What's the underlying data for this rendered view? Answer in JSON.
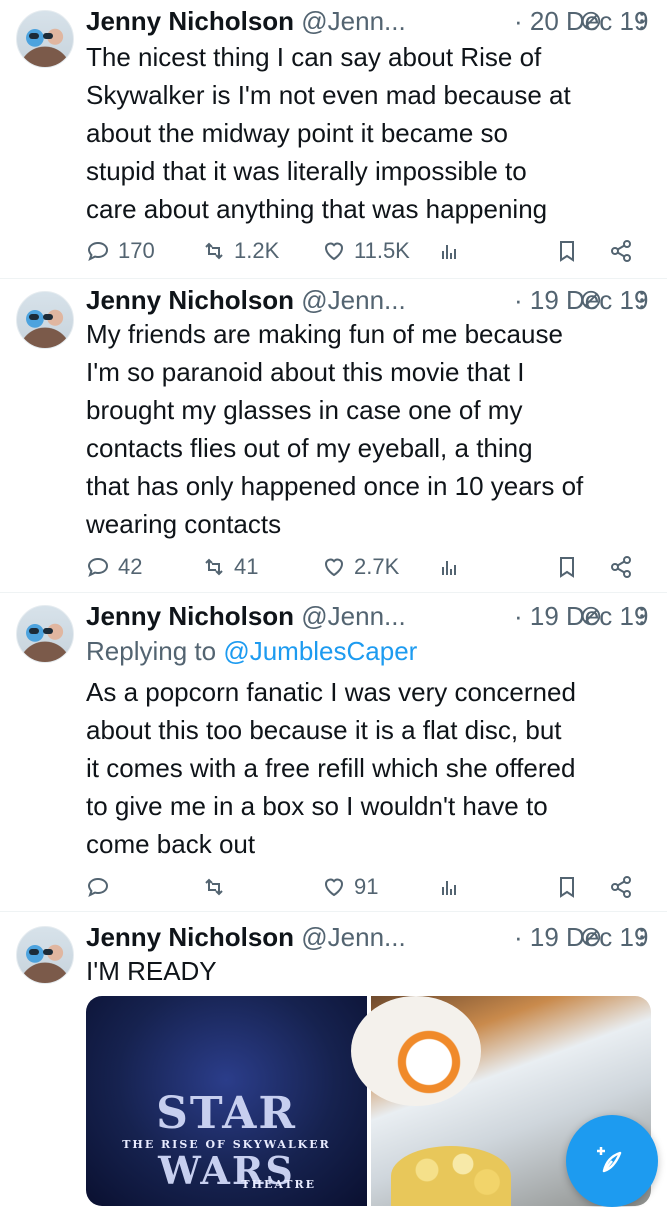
{
  "colors": {
    "accent": "#1d9bf0",
    "muted": "#536471",
    "text": "#0f1419"
  },
  "tweets": [
    {
      "name": "Jenny Nicholson",
      "handle": "@Jenn...",
      "date": "· 20 Dec 19",
      "text_lines": [
        "The nicest thing I can say about Rise of",
        "Skywalker is I'm not even mad because at",
        "about the midway point it became so",
        "stupid that it was literally impossible to",
        "care about anything that was happening"
      ],
      "replies": "170",
      "reposts": "1.2K",
      "likes": "11.5K"
    },
    {
      "name": "Jenny Nicholson",
      "handle": "@Jenn...",
      "date": "· 19 Dec 19",
      "text_lines": [
        "My friends are making fun of me because",
        "I'm so paranoid about this movie that I",
        "brought my glasses in case one of my",
        "contacts flies out of my eyeball, a thing",
        "that has only happened once in 10 years of",
        "wearing contacts"
      ],
      "replies": "42",
      "reposts": "41",
      "likes": "2.7K"
    },
    {
      "name": "Jenny Nicholson",
      "handle": "@Jenn...",
      "date": "· 19 Dec 19",
      "reply_prefix": "Replying to",
      "reply_user": "@JumblesCaper",
      "text_lines": [
        "As a popcorn fanatic I was very concerned",
        "about this too because it is a flat disc, but",
        "it comes with a free refill which she offered",
        "to give me in a box so I wouldn't have to",
        "come back out"
      ],
      "replies": "",
      "reposts": "",
      "likes": "91"
    },
    {
      "name": "Jenny Nicholson",
      "handle": "@Jenn...",
      "date": "· 19 Dec 19",
      "text_lines": [
        "I'M READY"
      ],
      "media": {
        "left_image_text": {
          "star": "STAR",
          "rise": "THE RISE OF SKYWALKER",
          "wars": "WARS",
          "theatre": "THEATRE"
        }
      }
    }
  ],
  "icons": {
    "reply": "speech-bubble-icon",
    "repost": "repost-arrows-icon",
    "like": "heart-icon",
    "views": "bar-chart-icon",
    "bookmark": "bookmark-icon",
    "share": "share-icon",
    "visibility": "no-entry-circle-icon",
    "more": "vertical-dots-icon",
    "compose": "feather-plus-icon"
  }
}
